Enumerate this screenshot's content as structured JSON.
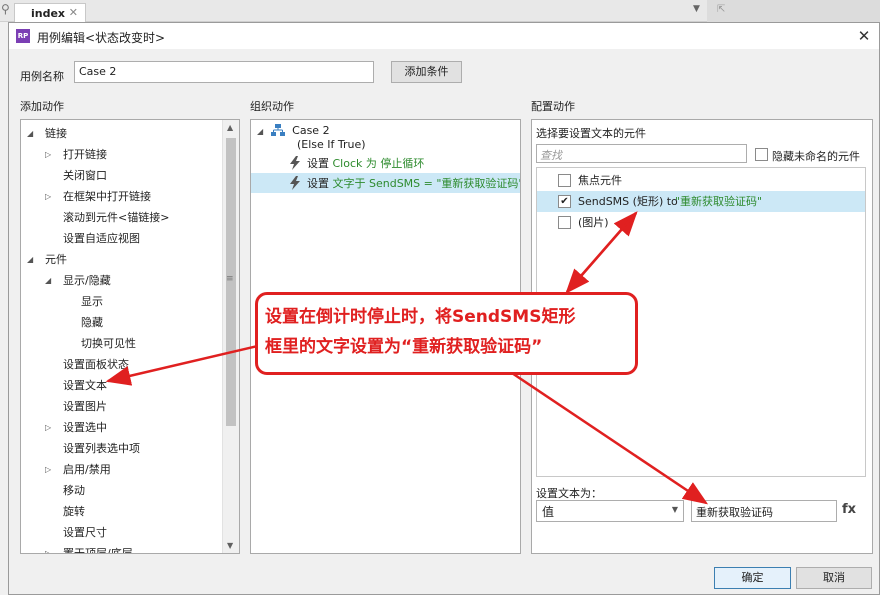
{
  "background": {
    "tab_label": "index",
    "tab_close": "✕"
  },
  "dialog": {
    "title": "用例编辑<状态改变时>",
    "case_name_label": "用例名称",
    "case_name_value": "Case 2",
    "add_condition_button": "添加条件",
    "ok_button": "确定",
    "cancel_button": "取消"
  },
  "sections": {
    "add_action": "添加动作",
    "organize_action": "组织动作",
    "configure_action": "配置动作"
  },
  "add_actions_tree": [
    {
      "label": "链接",
      "level": 0,
      "expander": "expanded"
    },
    {
      "label": "打开链接",
      "level": 1,
      "expander": "collapsed"
    },
    {
      "label": "关闭窗口",
      "level": 1,
      "expander": "none"
    },
    {
      "label": "在框架中打开链接",
      "level": 1,
      "expander": "collapsed"
    },
    {
      "label": "滚动到元件<锚链接>",
      "level": 1,
      "expander": "none"
    },
    {
      "label": "设置自适应视图",
      "level": 1,
      "expander": "none"
    },
    {
      "label": "元件",
      "level": 0,
      "expander": "expanded"
    },
    {
      "label": "显示/隐藏",
      "level": 1,
      "expander": "expanded"
    },
    {
      "label": "显示",
      "level": 2,
      "expander": "none"
    },
    {
      "label": "隐藏",
      "level": 2,
      "expander": "none"
    },
    {
      "label": "切换可见性",
      "level": 2,
      "expander": "none"
    },
    {
      "label": "设置面板状态",
      "level": 1,
      "expander": "none"
    },
    {
      "label": "设置文本",
      "level": 1,
      "expander": "none"
    },
    {
      "label": "设置图片",
      "level": 1,
      "expander": "none"
    },
    {
      "label": "设置选中",
      "level": 1,
      "expander": "collapsed"
    },
    {
      "label": "设置列表选中项",
      "level": 1,
      "expander": "none"
    },
    {
      "label": "启用/禁用",
      "level": 1,
      "expander": "collapsed"
    },
    {
      "label": "移动",
      "level": 1,
      "expander": "none"
    },
    {
      "label": "旋转",
      "level": 1,
      "expander": "none"
    },
    {
      "label": "设置尺寸",
      "level": 1,
      "expander": "none"
    },
    {
      "label": "置于顶层/底层",
      "level": 1,
      "expander": "collapsed"
    }
  ],
  "organize": {
    "case_label": "Case 2",
    "condition": "(Else If True)",
    "action1": {
      "prefix": "设置 ",
      "target": "Clock 为 停止循环"
    },
    "action2": {
      "prefix": "设置 ",
      "target": "文字于 SendSMS = \"重新获取验证码\""
    }
  },
  "configure": {
    "select_widgets_label": "选择要设置文本的元件",
    "search_placeholder": "查找",
    "hide_unnamed_label": "隐藏未命名的元件",
    "widgets": [
      {
        "label": "焦点元件",
        "checked": false,
        "suffix": ""
      },
      {
        "label": "SendSMS (矩形) to ",
        "checked": true,
        "suffix": "\"重新获取验证码\""
      },
      {
        "label": "(图片)",
        "checked": false,
        "suffix": ""
      }
    ],
    "set_text_label": "设置文本为：",
    "value_type": "值",
    "text_value": "重新获取验证码",
    "fx_label": "fx"
  },
  "annotation": {
    "line1": "设置在倒计时停止时，将SendSMS矩形",
    "line2": "框里的文字设置为“重新获取验证码”"
  },
  "colors": {
    "accent_green": "#2e8b2e",
    "annotation_red": "#e02020",
    "selection_blue": "#cce8f6"
  }
}
